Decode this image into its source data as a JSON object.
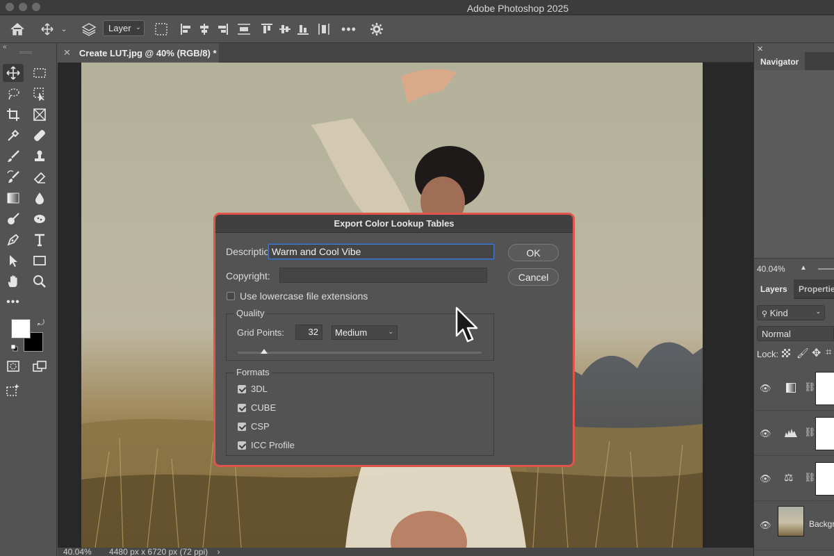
{
  "window": {
    "title": "Adobe Photoshop 2025"
  },
  "options_bar": {
    "layer_select_value": "Layer"
  },
  "document": {
    "tab_label": "Create LUT.jpg @ 40% (RGB/8) *",
    "status_zoom": "40.04%",
    "status_info": "4480 px x 6720 px (72 ppi)"
  },
  "dialog": {
    "title": "Export Color Lookup Tables",
    "description_label": "Description:",
    "description_value": "Warm and Cool Vibe",
    "copyright_label": "Copyright:",
    "copyright_value": "",
    "lowercase_label": "Use lowercase file extensions",
    "lowercase_checked": false,
    "ok_label": "OK",
    "cancel_label": "Cancel",
    "quality_legend": "Quality",
    "grid_points_label": "Grid Points:",
    "grid_points_value": "32",
    "quality_preset": "Medium",
    "formats_legend": "Formats",
    "formats": [
      {
        "label": "3DL",
        "checked": true
      },
      {
        "label": "CUBE",
        "checked": true
      },
      {
        "label": "CSP",
        "checked": true
      },
      {
        "label": "ICC Profile",
        "checked": true
      }
    ]
  },
  "right_panel": {
    "navigator_tab": "Navigator",
    "navigator_zoom": "40.04%",
    "layers_tab": "Layers",
    "properties_tab": "Properties",
    "filter_kind": "Kind",
    "blend_mode": "Normal",
    "lock_label": "Lock:",
    "background_layer_label": "Background"
  },
  "colors": {
    "dialog_highlight": "#e2544a",
    "focus_ring": "#4d7cc6",
    "ui_bg": "#535353"
  }
}
